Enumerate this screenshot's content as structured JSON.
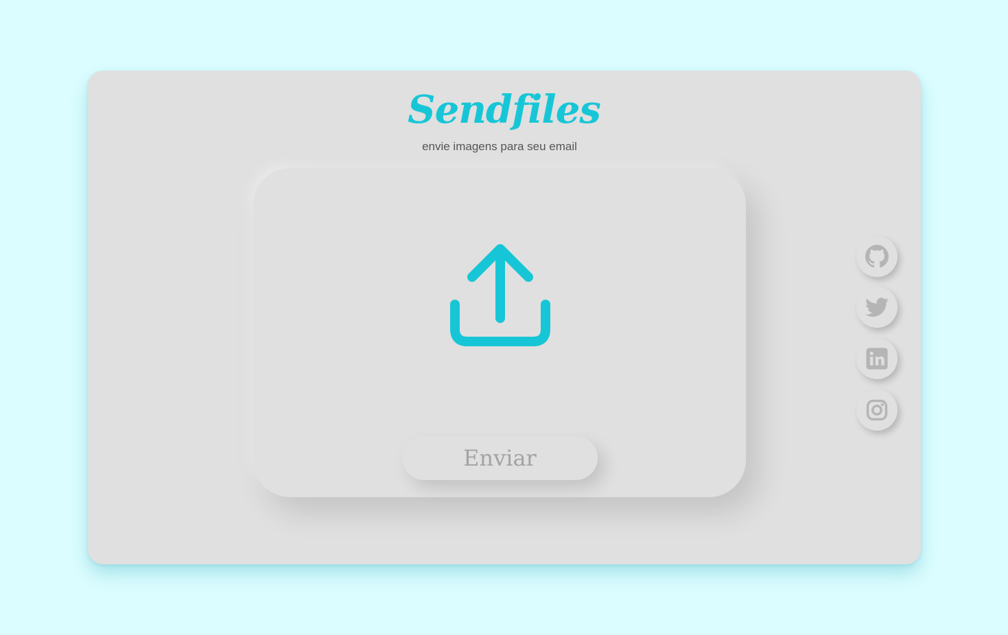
{
  "header": {
    "title": "Sendfiles",
    "subtitle": "envie imagens para seu email"
  },
  "upload": {
    "icon": "upload-icon",
    "button_label": "Enviar"
  },
  "social": [
    {
      "name": "github",
      "icon": "github-icon"
    },
    {
      "name": "twitter",
      "icon": "twitter-icon"
    },
    {
      "name": "linkedin",
      "icon": "linkedin-icon"
    },
    {
      "name": "instagram",
      "icon": "instagram-icon"
    }
  ],
  "colors": {
    "background": "#dcfdff",
    "card": "#e0e0e0",
    "accent": "#17c6d6",
    "muted_text": "#a3a3a3",
    "icon_gray": "#b5b5b5"
  }
}
